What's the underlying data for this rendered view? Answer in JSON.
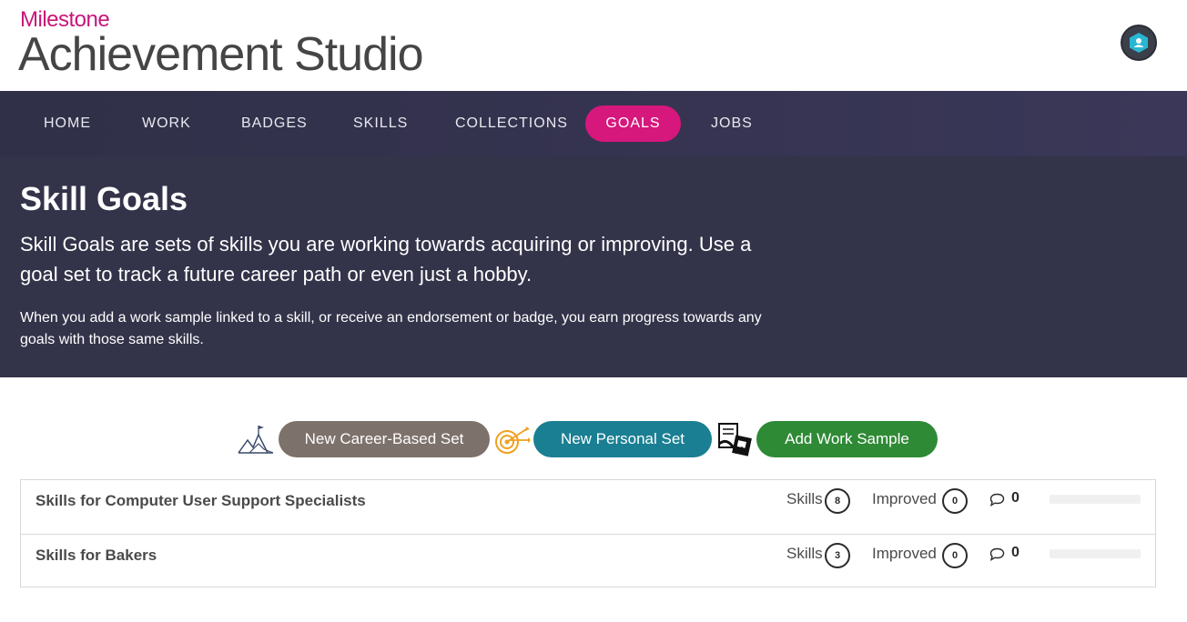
{
  "brand": {
    "company": "Milestone",
    "product": "Achievement Studio"
  },
  "nav": {
    "items": [
      {
        "label": "HOME"
      },
      {
        "label": "WORK"
      },
      {
        "label": "BADGES"
      },
      {
        "label": "SKILLS"
      },
      {
        "label": "COLLECTIONS"
      },
      {
        "label": "GOALS",
        "active": true
      },
      {
        "label": "JOBS"
      }
    ]
  },
  "hero": {
    "title": "Skill Goals",
    "lead": "Skill Goals are sets of skills you are working towards acquiring or improving. Use a goal set to track a future career path or even just a hobby.",
    "note": "When you add a work sample linked to a skill, or receive an endorsement or badge, you earn progress towards any goals with those same skills."
  },
  "actions": {
    "career_label": "New Career-Based Set",
    "personal_label": "New Personal Set",
    "work_label": "Add Work Sample"
  },
  "goals": [
    {
      "name": "Skills for Computer User Support Specialists",
      "skills_label": "Skills",
      "skills": "8",
      "improved_label": "Improved",
      "improved": "0",
      "comments": "0",
      "progress": 0
    },
    {
      "name": "Skills for Bakers",
      "skills_label": "Skills",
      "skills": "3",
      "improved_label": "Improved",
      "improved": "0",
      "comments": "0",
      "progress": 0
    }
  ],
  "colors": {
    "brand_pink": "#d6177c",
    "nav_bg": "#303048",
    "career_button": "#7d716b",
    "personal_button": "#1a7f93",
    "work_button": "#2e8a35"
  },
  "icons": {
    "avatar": "user-hexagon-icon",
    "career": "mountains-flag-icon",
    "personal": "target-arrows-icon",
    "work": "documents-link-icon",
    "comments": "speech-bubble-icon"
  }
}
